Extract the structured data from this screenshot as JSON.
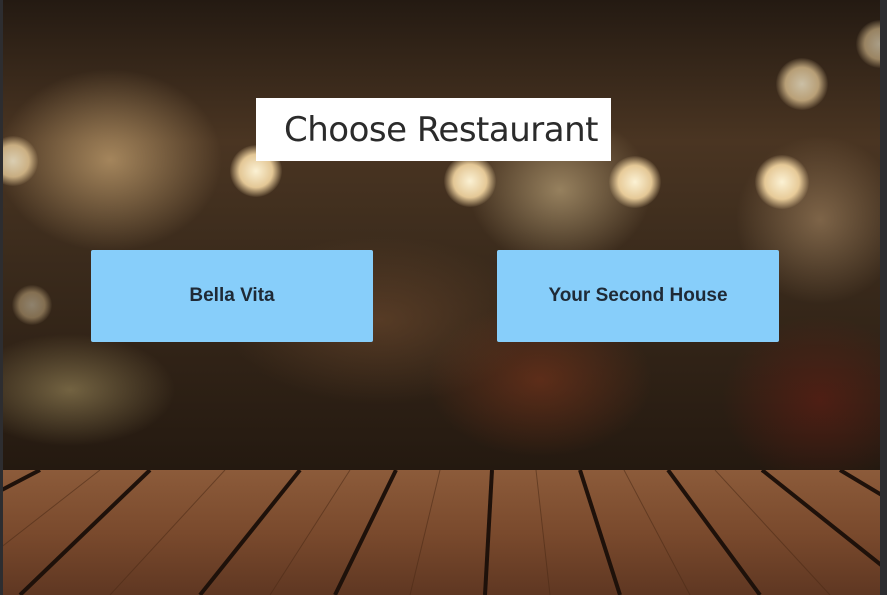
{
  "page": {
    "title": "Choose Restaurant"
  },
  "restaurants": [
    {
      "label": "Bella Vita"
    },
    {
      "label": "Your Second House"
    }
  ],
  "colors": {
    "button_bg": "#87cefa",
    "button_text": "#1f2a36",
    "title_bg": "#ffffff",
    "title_text": "#2b2b2b"
  }
}
